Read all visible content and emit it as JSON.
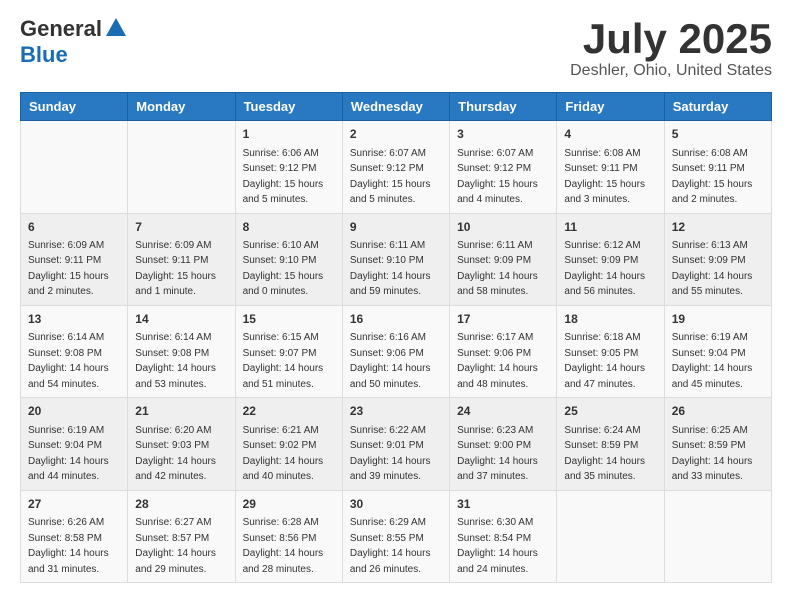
{
  "header": {
    "logo_general": "General",
    "logo_blue": "Blue",
    "month_title": "July 2025",
    "location": "Deshler, Ohio, United States"
  },
  "weekdays": [
    "Sunday",
    "Monday",
    "Tuesday",
    "Wednesday",
    "Thursday",
    "Friday",
    "Saturday"
  ],
  "weeks": [
    [
      {
        "day": "",
        "info": ""
      },
      {
        "day": "",
        "info": ""
      },
      {
        "day": "1",
        "info": "Sunrise: 6:06 AM\nSunset: 9:12 PM\nDaylight: 15 hours and 5 minutes."
      },
      {
        "day": "2",
        "info": "Sunrise: 6:07 AM\nSunset: 9:12 PM\nDaylight: 15 hours and 5 minutes."
      },
      {
        "day": "3",
        "info": "Sunrise: 6:07 AM\nSunset: 9:12 PM\nDaylight: 15 hours and 4 minutes."
      },
      {
        "day": "4",
        "info": "Sunrise: 6:08 AM\nSunset: 9:11 PM\nDaylight: 15 hours and 3 minutes."
      },
      {
        "day": "5",
        "info": "Sunrise: 6:08 AM\nSunset: 9:11 PM\nDaylight: 15 hours and 2 minutes."
      }
    ],
    [
      {
        "day": "6",
        "info": "Sunrise: 6:09 AM\nSunset: 9:11 PM\nDaylight: 15 hours and 2 minutes."
      },
      {
        "day": "7",
        "info": "Sunrise: 6:09 AM\nSunset: 9:11 PM\nDaylight: 15 hours and 1 minute."
      },
      {
        "day": "8",
        "info": "Sunrise: 6:10 AM\nSunset: 9:10 PM\nDaylight: 15 hours and 0 minutes."
      },
      {
        "day": "9",
        "info": "Sunrise: 6:11 AM\nSunset: 9:10 PM\nDaylight: 14 hours and 59 minutes."
      },
      {
        "day": "10",
        "info": "Sunrise: 6:11 AM\nSunset: 9:09 PM\nDaylight: 14 hours and 58 minutes."
      },
      {
        "day": "11",
        "info": "Sunrise: 6:12 AM\nSunset: 9:09 PM\nDaylight: 14 hours and 56 minutes."
      },
      {
        "day": "12",
        "info": "Sunrise: 6:13 AM\nSunset: 9:09 PM\nDaylight: 14 hours and 55 minutes."
      }
    ],
    [
      {
        "day": "13",
        "info": "Sunrise: 6:14 AM\nSunset: 9:08 PM\nDaylight: 14 hours and 54 minutes."
      },
      {
        "day": "14",
        "info": "Sunrise: 6:14 AM\nSunset: 9:08 PM\nDaylight: 14 hours and 53 minutes."
      },
      {
        "day": "15",
        "info": "Sunrise: 6:15 AM\nSunset: 9:07 PM\nDaylight: 14 hours and 51 minutes."
      },
      {
        "day": "16",
        "info": "Sunrise: 6:16 AM\nSunset: 9:06 PM\nDaylight: 14 hours and 50 minutes."
      },
      {
        "day": "17",
        "info": "Sunrise: 6:17 AM\nSunset: 9:06 PM\nDaylight: 14 hours and 48 minutes."
      },
      {
        "day": "18",
        "info": "Sunrise: 6:18 AM\nSunset: 9:05 PM\nDaylight: 14 hours and 47 minutes."
      },
      {
        "day": "19",
        "info": "Sunrise: 6:19 AM\nSunset: 9:04 PM\nDaylight: 14 hours and 45 minutes."
      }
    ],
    [
      {
        "day": "20",
        "info": "Sunrise: 6:19 AM\nSunset: 9:04 PM\nDaylight: 14 hours and 44 minutes."
      },
      {
        "day": "21",
        "info": "Sunrise: 6:20 AM\nSunset: 9:03 PM\nDaylight: 14 hours and 42 minutes."
      },
      {
        "day": "22",
        "info": "Sunrise: 6:21 AM\nSunset: 9:02 PM\nDaylight: 14 hours and 40 minutes."
      },
      {
        "day": "23",
        "info": "Sunrise: 6:22 AM\nSunset: 9:01 PM\nDaylight: 14 hours and 39 minutes."
      },
      {
        "day": "24",
        "info": "Sunrise: 6:23 AM\nSunset: 9:00 PM\nDaylight: 14 hours and 37 minutes."
      },
      {
        "day": "25",
        "info": "Sunrise: 6:24 AM\nSunset: 8:59 PM\nDaylight: 14 hours and 35 minutes."
      },
      {
        "day": "26",
        "info": "Sunrise: 6:25 AM\nSunset: 8:59 PM\nDaylight: 14 hours and 33 minutes."
      }
    ],
    [
      {
        "day": "27",
        "info": "Sunrise: 6:26 AM\nSunset: 8:58 PM\nDaylight: 14 hours and 31 minutes."
      },
      {
        "day": "28",
        "info": "Sunrise: 6:27 AM\nSunset: 8:57 PM\nDaylight: 14 hours and 29 minutes."
      },
      {
        "day": "29",
        "info": "Sunrise: 6:28 AM\nSunset: 8:56 PM\nDaylight: 14 hours and 28 minutes."
      },
      {
        "day": "30",
        "info": "Sunrise: 6:29 AM\nSunset: 8:55 PM\nDaylight: 14 hours and 26 minutes."
      },
      {
        "day": "31",
        "info": "Sunrise: 6:30 AM\nSunset: 8:54 PM\nDaylight: 14 hours and 24 minutes."
      },
      {
        "day": "",
        "info": ""
      },
      {
        "day": "",
        "info": ""
      }
    ]
  ]
}
